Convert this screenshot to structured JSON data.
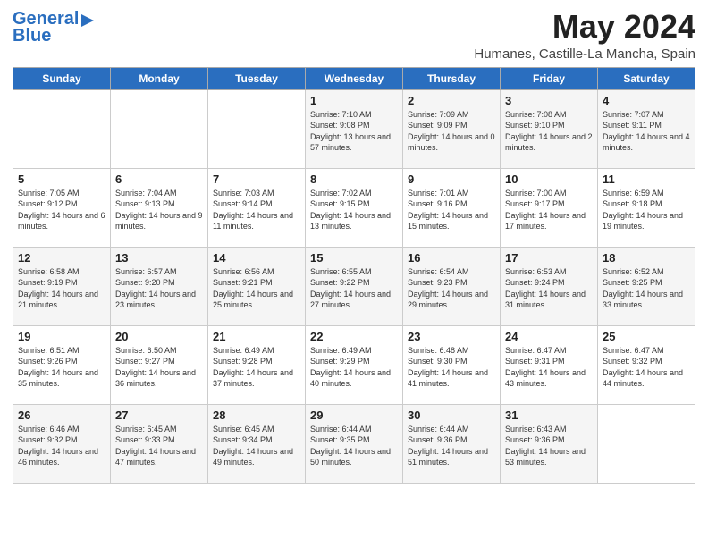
{
  "header": {
    "logo_line1": "General",
    "logo_line2": "Blue",
    "month_title": "May 2024",
    "location": "Humanes, Castille-La Mancha, Spain"
  },
  "weekdays": [
    "Sunday",
    "Monday",
    "Tuesday",
    "Wednesday",
    "Thursday",
    "Friday",
    "Saturday"
  ],
  "weeks": [
    [
      {
        "day": "",
        "info": ""
      },
      {
        "day": "",
        "info": ""
      },
      {
        "day": "",
        "info": ""
      },
      {
        "day": "1",
        "info": "Sunrise: 7:10 AM\nSunset: 9:08 PM\nDaylight: 13 hours and 57 minutes."
      },
      {
        "day": "2",
        "info": "Sunrise: 7:09 AM\nSunset: 9:09 PM\nDaylight: 14 hours and 0 minutes."
      },
      {
        "day": "3",
        "info": "Sunrise: 7:08 AM\nSunset: 9:10 PM\nDaylight: 14 hours and 2 minutes."
      },
      {
        "day": "4",
        "info": "Sunrise: 7:07 AM\nSunset: 9:11 PM\nDaylight: 14 hours and 4 minutes."
      }
    ],
    [
      {
        "day": "5",
        "info": "Sunrise: 7:05 AM\nSunset: 9:12 PM\nDaylight: 14 hours and 6 minutes."
      },
      {
        "day": "6",
        "info": "Sunrise: 7:04 AM\nSunset: 9:13 PM\nDaylight: 14 hours and 9 minutes."
      },
      {
        "day": "7",
        "info": "Sunrise: 7:03 AM\nSunset: 9:14 PM\nDaylight: 14 hours and 11 minutes."
      },
      {
        "day": "8",
        "info": "Sunrise: 7:02 AM\nSunset: 9:15 PM\nDaylight: 14 hours and 13 minutes."
      },
      {
        "day": "9",
        "info": "Sunrise: 7:01 AM\nSunset: 9:16 PM\nDaylight: 14 hours and 15 minutes."
      },
      {
        "day": "10",
        "info": "Sunrise: 7:00 AM\nSunset: 9:17 PM\nDaylight: 14 hours and 17 minutes."
      },
      {
        "day": "11",
        "info": "Sunrise: 6:59 AM\nSunset: 9:18 PM\nDaylight: 14 hours and 19 minutes."
      }
    ],
    [
      {
        "day": "12",
        "info": "Sunrise: 6:58 AM\nSunset: 9:19 PM\nDaylight: 14 hours and 21 minutes."
      },
      {
        "day": "13",
        "info": "Sunrise: 6:57 AM\nSunset: 9:20 PM\nDaylight: 14 hours and 23 minutes."
      },
      {
        "day": "14",
        "info": "Sunrise: 6:56 AM\nSunset: 9:21 PM\nDaylight: 14 hours and 25 minutes."
      },
      {
        "day": "15",
        "info": "Sunrise: 6:55 AM\nSunset: 9:22 PM\nDaylight: 14 hours and 27 minutes."
      },
      {
        "day": "16",
        "info": "Sunrise: 6:54 AM\nSunset: 9:23 PM\nDaylight: 14 hours and 29 minutes."
      },
      {
        "day": "17",
        "info": "Sunrise: 6:53 AM\nSunset: 9:24 PM\nDaylight: 14 hours and 31 minutes."
      },
      {
        "day": "18",
        "info": "Sunrise: 6:52 AM\nSunset: 9:25 PM\nDaylight: 14 hours and 33 minutes."
      }
    ],
    [
      {
        "day": "19",
        "info": "Sunrise: 6:51 AM\nSunset: 9:26 PM\nDaylight: 14 hours and 35 minutes."
      },
      {
        "day": "20",
        "info": "Sunrise: 6:50 AM\nSunset: 9:27 PM\nDaylight: 14 hours and 36 minutes."
      },
      {
        "day": "21",
        "info": "Sunrise: 6:49 AM\nSunset: 9:28 PM\nDaylight: 14 hours and 37 minutes."
      },
      {
        "day": "22",
        "info": "Sunrise: 6:49 AM\nSunset: 9:29 PM\nDaylight: 14 hours and 40 minutes."
      },
      {
        "day": "23",
        "info": "Sunrise: 6:48 AM\nSunset: 9:30 PM\nDaylight: 14 hours and 41 minutes."
      },
      {
        "day": "24",
        "info": "Sunrise: 6:47 AM\nSunset: 9:31 PM\nDaylight: 14 hours and 43 minutes."
      },
      {
        "day": "25",
        "info": "Sunrise: 6:47 AM\nSunset: 9:32 PM\nDaylight: 14 hours and 44 minutes."
      }
    ],
    [
      {
        "day": "26",
        "info": "Sunrise: 6:46 AM\nSunset: 9:32 PM\nDaylight: 14 hours and 46 minutes."
      },
      {
        "day": "27",
        "info": "Sunrise: 6:45 AM\nSunset: 9:33 PM\nDaylight: 14 hours and 47 minutes."
      },
      {
        "day": "28",
        "info": "Sunrise: 6:45 AM\nSunset: 9:34 PM\nDaylight: 14 hours and 49 minutes."
      },
      {
        "day": "29",
        "info": "Sunrise: 6:44 AM\nSunset: 9:35 PM\nDaylight: 14 hours and 50 minutes."
      },
      {
        "day": "30",
        "info": "Sunrise: 6:44 AM\nSunset: 9:36 PM\nDaylight: 14 hours and 51 minutes."
      },
      {
        "day": "31",
        "info": "Sunrise: 6:43 AM\nSunset: 9:36 PM\nDaylight: 14 hours and 53 minutes."
      },
      {
        "day": "",
        "info": ""
      }
    ]
  ]
}
